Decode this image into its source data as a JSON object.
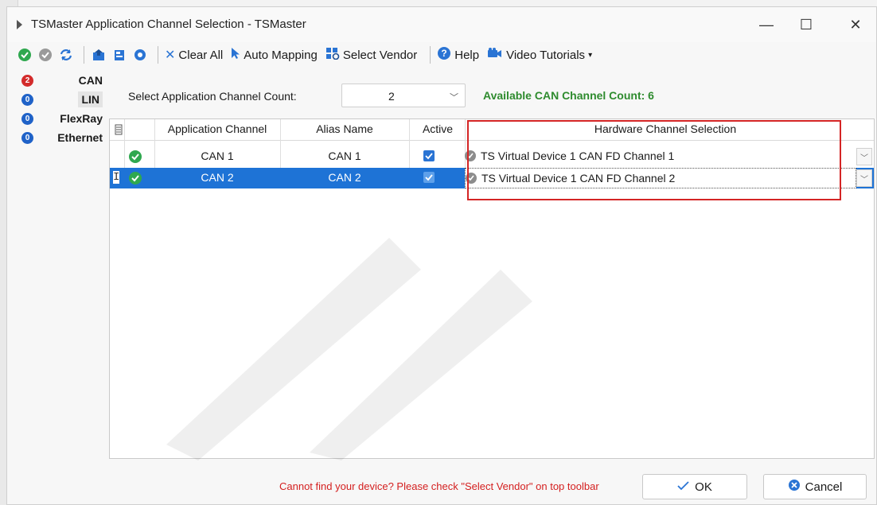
{
  "window": {
    "title": "TSMaster Application Channel Selection - TSMaster",
    "minimize_glyph": "—",
    "maximize_glyph": "☐",
    "close_glyph": "✕"
  },
  "toolbar": {
    "clear_all": "Clear All",
    "auto_mapping": "Auto Mapping",
    "select_vendor": "Select Vendor",
    "help": "Help",
    "video_tutorials": "Video Tutorials"
  },
  "sidebar": {
    "items": [
      {
        "label": "CAN",
        "count": "2",
        "color": "#d32b2b"
      },
      {
        "label": "LIN",
        "count": "0",
        "color": "#1f62c8"
      },
      {
        "label": "FlexRay",
        "count": "0",
        "color": "#1f62c8"
      },
      {
        "label": "Ethernet",
        "count": "0",
        "color": "#1f62c8"
      }
    ]
  },
  "channel_count": {
    "label": "Select Application Channel Count:",
    "value": "2",
    "available": "Available CAN Channel Count: 6"
  },
  "grid": {
    "headers": {
      "application_channel": "Application Channel",
      "alias_name": "Alias Name",
      "active": "Active",
      "hardware_channel": "Hardware Channel Selection"
    },
    "rows": [
      {
        "app_channel": "CAN 1",
        "alias": "CAN 1",
        "active": true,
        "hardware": "TS Virtual Device 1 CAN FD Channel 1"
      },
      {
        "app_channel": "CAN 2",
        "alias": "CAN 2",
        "active": true,
        "hardware": "TS Virtual Device 1 CAN FD Channel 2"
      }
    ]
  },
  "footer": {
    "message": "Cannot find your device? Please check \"Select Vendor\" on top toolbar",
    "ok": "OK",
    "cancel": "Cancel"
  },
  "colors": {
    "selection": "#1e73d6",
    "available_text": "#2e8b2e",
    "warning_text": "#d41f1f",
    "highlight_box": "#d42525"
  }
}
